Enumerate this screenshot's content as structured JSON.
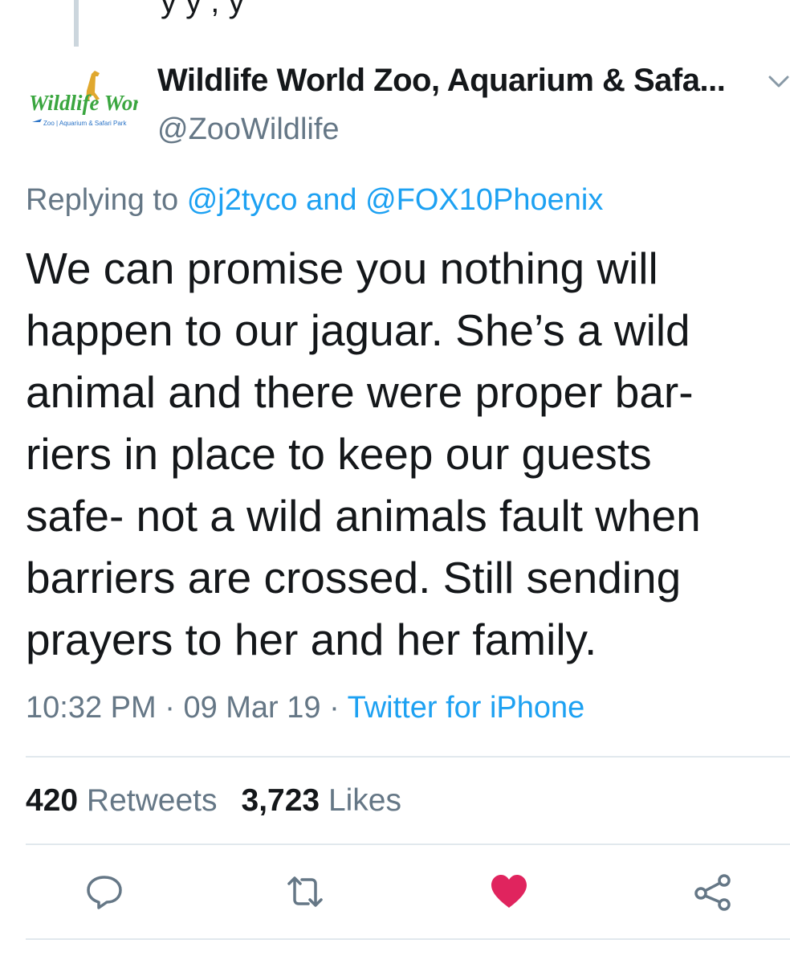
{
  "thread": {
    "previous_text_fragment": "y                                               y   ,            y"
  },
  "author": {
    "name": "Wildlife World Zoo, Aquarium & Safa...",
    "handle": "@ZooWildlife",
    "logo_text": "Wildlife World",
    "logo_subtext": "Zoo | Aquarium & Safari Park"
  },
  "reply": {
    "prefix": "Replying to",
    "mention1": "@j2tyco",
    "conjunction": "and",
    "mention2": "@FOX10Phoenix"
  },
  "tweet": {
    "lines": [
      "We can promise you nothing will",
      "happen to our jaguar. She’s a wild",
      "animal and there were proper bar-",
      "riers in place to keep our guests",
      "safe- not a wild animals fault when",
      "barriers are crossed. Still sending",
      "prayers to her and her family."
    ]
  },
  "meta": {
    "time": "10:32 PM",
    "separator": "·",
    "date": "09 Mar 19",
    "source": "Twitter for iPhone"
  },
  "stats": {
    "retweets_count": "420",
    "retweets_label": "Retweets",
    "likes_count": "3,723",
    "likes_label": "Likes"
  },
  "actions": {
    "reply_icon": "reply-icon",
    "retweet_icon": "retweet-icon",
    "like_icon": "heart-icon",
    "share_icon": "share-icon",
    "liked": true
  },
  "colors": {
    "text": "#14171a",
    "secondary": "#657786",
    "link": "#1da1f2",
    "like": "#e0245e",
    "divider": "#e1e8ed"
  }
}
